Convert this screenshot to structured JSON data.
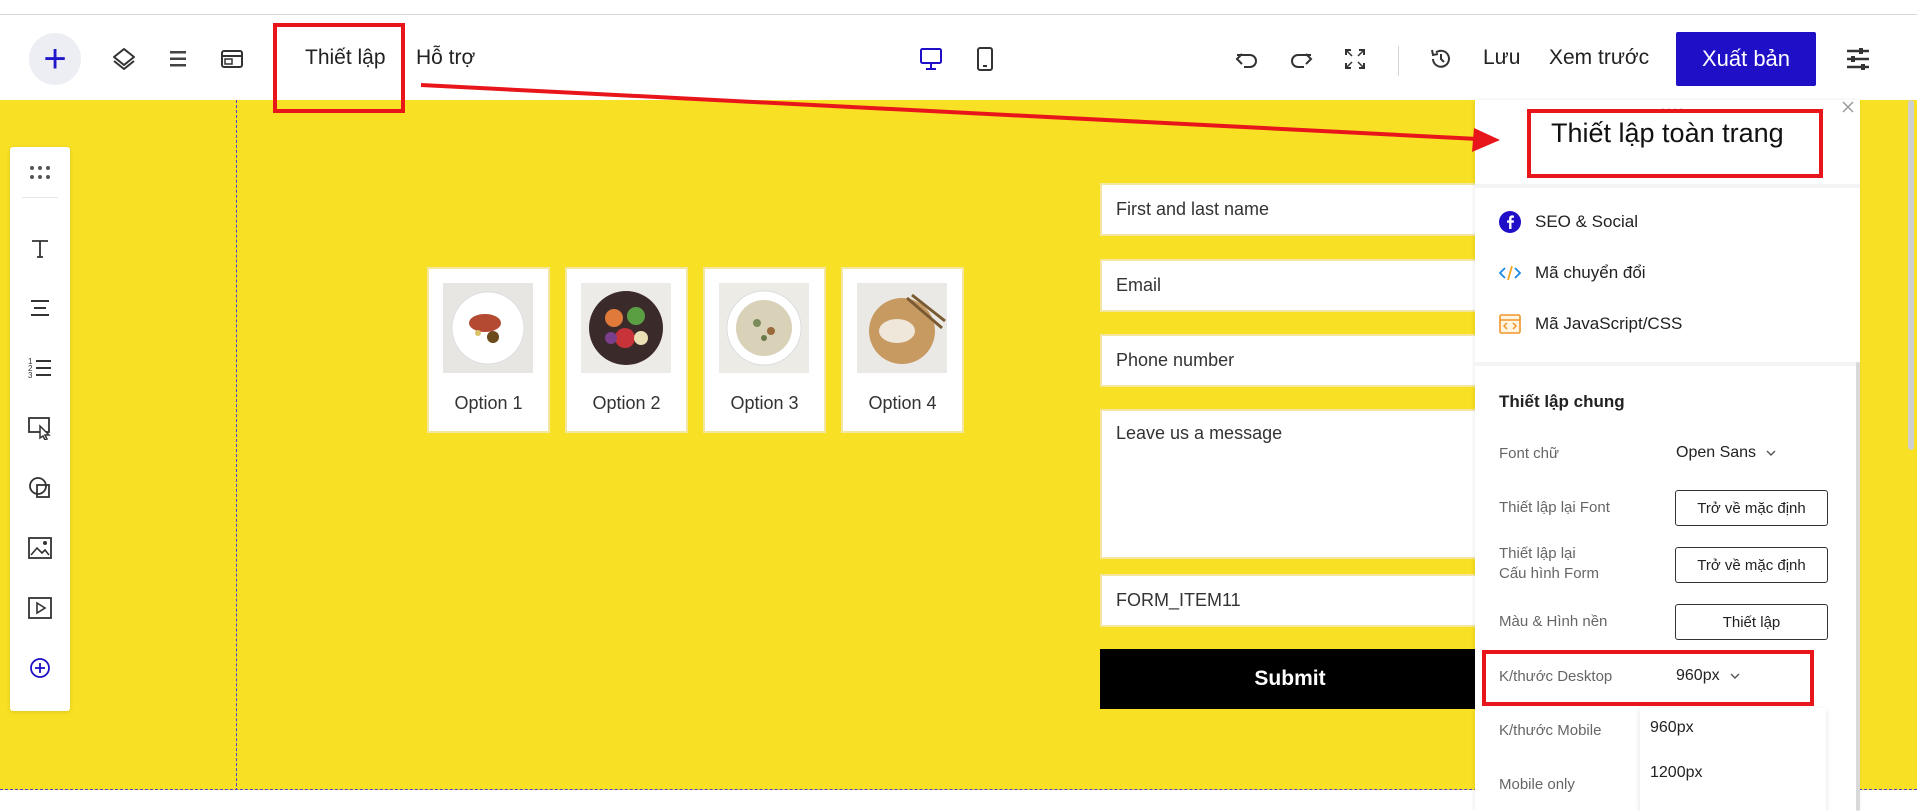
{
  "toolbar": {
    "add_glyph": "+",
    "settings_label": "Thiết lập",
    "support_label": "Hỗ trợ",
    "save_label": "Lưu",
    "preview_label": "Xem trước",
    "publish_label": "Xuất bản",
    "icons": [
      "plus-icon",
      "layers-icon",
      "list-icon",
      "browser-window-icon",
      "desktop-icon",
      "tablet-icon",
      "undo-icon",
      "redo-icon",
      "fullscreen-icon",
      "history-icon",
      "sliders-icon"
    ]
  },
  "left_panel": {
    "icons": [
      "grip-dots-icon",
      "text-icon",
      "paragraph-icon",
      "list-numbered-icon",
      "cursor-select-icon",
      "shapes-icon",
      "image-icon",
      "video-icon",
      "add-circle-icon"
    ]
  },
  "options": [
    {
      "label": "Option 1"
    },
    {
      "label": "Option 2"
    },
    {
      "label": "Option 3"
    },
    {
      "label": "Option 4"
    }
  ],
  "form": {
    "name_placeholder": "First and last name",
    "email_placeholder": "Email",
    "phone_placeholder": "Phone number",
    "message_placeholder": "Leave us a message",
    "custom_field": "FORM_ITEM11",
    "submit_label": "Submit"
  },
  "panel": {
    "title": "Thiết lập toàn trang",
    "links": [
      {
        "label": "SEO & Social",
        "icon": "facebook-icon"
      },
      {
        "label": "Mã chuyển đổi",
        "icon": "code-icon"
      },
      {
        "label": "Mã JavaScript/CSS",
        "icon": "code-window-icon"
      }
    ],
    "general_heading": "Thiết lập chung",
    "font_label": "Font chữ",
    "font_value": "Open Sans",
    "reset_font_label": "Thiết lập lại Font",
    "reset_font_button": "Trở về mặc định",
    "reset_form_label_line1": "Thiết lập lại",
    "reset_form_label_line2": "Cấu hình Form",
    "reset_form_button": "Trở về mặc định",
    "color_bg_label": "Màu & Hình nền",
    "color_bg_button": "Thiết lập",
    "desktop_size_label": "K/thước Desktop",
    "desktop_size_value": "960px",
    "mobile_size_label": "K/thước Mobile",
    "mobile_only_label": "Mobile only",
    "size_options": [
      "960px",
      "1200px"
    ]
  },
  "colors": {
    "accent": "#1f0fc7",
    "canvas": "#f8e024",
    "annotation": "#e8161b",
    "submit": "#000000"
  }
}
